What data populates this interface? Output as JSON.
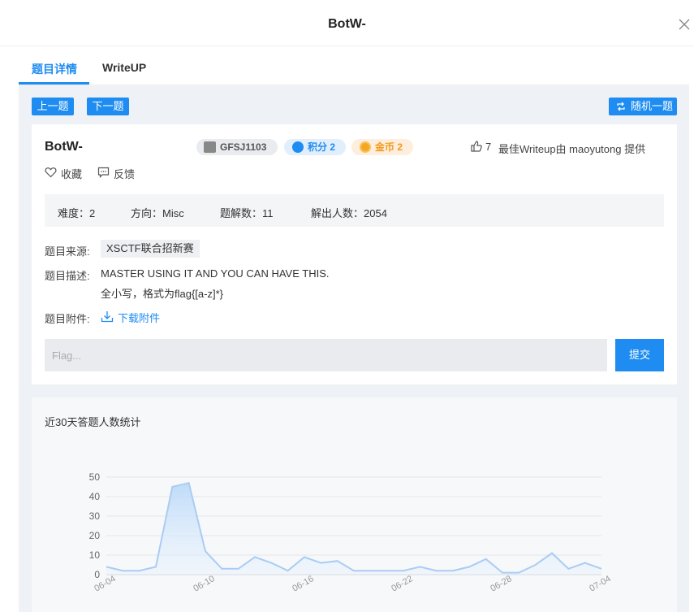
{
  "header": {
    "title": "BotW-"
  },
  "tabs": [
    {
      "label": "题目详情",
      "active": true
    },
    {
      "label": "WriteUP",
      "active": false
    }
  ],
  "nav": {
    "prev": "上一题",
    "next": "下一题",
    "random": "随机一题"
  },
  "challenge": {
    "name": "BotW-",
    "author": "GFSJ1103",
    "score": "积分 2",
    "coins": "金币 2",
    "likes": "7",
    "best_writeup": "最佳Writeup由 maoyutong 提供",
    "favorite": "收藏",
    "feedback": "反馈",
    "difficulty": "难度：2",
    "direction": "方向：Misc",
    "solutions": "题解数：11",
    "solvers": "解出人数：2054",
    "source_label": "题目来源:",
    "source": "XSCTF联合招新赛",
    "desc_label": "题目描述:",
    "desc_line1": "MASTER USING IT AND YOU CAN HAVE THIS.",
    "desc_line2": "全小写，格式为flag{[a-z]*}",
    "attach_label": "题目附件:",
    "download": "下载附件",
    "flag_placeholder": "Flag...",
    "submit": "提交"
  },
  "colors": {
    "accent": "#1e8cf0",
    "coin": "#f39a1c",
    "background": "#eef1f5"
  },
  "chart_data": {
    "type": "area",
    "title": "近30天答题人数统计",
    "x": [
      "06-04",
      "06-05",
      "06-06",
      "06-07",
      "06-08",
      "06-09",
      "06-10",
      "06-11",
      "06-12",
      "06-13",
      "06-14",
      "06-15",
      "06-16",
      "06-17",
      "06-18",
      "06-19",
      "06-20",
      "06-21",
      "06-22",
      "06-23",
      "06-24",
      "06-25",
      "06-26",
      "06-27",
      "06-28",
      "06-29",
      "06-30",
      "07-01",
      "07-02",
      "07-03",
      "07-04"
    ],
    "xticks": [
      "06-04",
      "06-10",
      "06-16",
      "06-22",
      "06-28",
      "07-04"
    ],
    "values": [
      4,
      2,
      2,
      4,
      45,
      47,
      12,
      3,
      3,
      9,
      6,
      2,
      9,
      6,
      7,
      2,
      2,
      2,
      2,
      4,
      2,
      2,
      4,
      8,
      1,
      1,
      5,
      11,
      3,
      6,
      3
    ],
    "ylim": [
      0,
      50
    ],
    "yticks": [
      0,
      10,
      20,
      30,
      40,
      50
    ],
    "grid": true
  }
}
